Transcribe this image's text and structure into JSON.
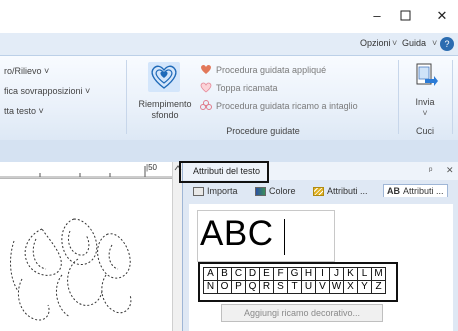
{
  "window": {
    "controls": {
      "minimize": "–",
      "maximize": "☐",
      "close": "✕"
    }
  },
  "ribbon_tabs": {
    "options": "Opzioni",
    "guide": "Guida",
    "chevron": "˅",
    "help_icon": "?"
  },
  "ribbon": {
    "left_items": [
      "ro/Rilievo ˅",
      "fica sovrapposizioni ˅",
      "tta testo ˅"
    ],
    "fill_button": {
      "line1": "Riempimento",
      "line2": "sfondo"
    },
    "wizards": [
      {
        "label": "Procedura guidata appliqué",
        "icon": "heart-icon"
      },
      {
        "label": "Toppa ricamata",
        "icon": "heart-outline-icon"
      },
      {
        "label": "Procedura guidata ricamo a intaglio",
        "icon": "flower-icon"
      }
    ],
    "wizards_group_label": "Procedure guidate",
    "send_button": {
      "label": "Invia",
      "arrow": "˅"
    },
    "cuci_label": "Cuci"
  },
  "ruler": {
    "mark": "|50"
  },
  "pane": {
    "title": "Attributi del testo",
    "pin": "ᵖ",
    "close": "✕",
    "tabs": [
      {
        "label": "Importa",
        "icon": "import-icon"
      },
      {
        "label": "Colore",
        "icon": "color-icon"
      },
      {
        "label": "Attributi ...",
        "icon": "stitch-attributes-icon"
      },
      {
        "label": "Attributi ...",
        "icon": "text-attributes-icon",
        "prefix": "AB",
        "active": true
      }
    ],
    "preview_text": "ABC",
    "alphabet_row1": [
      "A",
      "B",
      "C",
      "D",
      "E",
      "F",
      "G",
      "H",
      "I",
      "J",
      "K",
      "L",
      "M"
    ],
    "alphabet_row2": [
      "N",
      "O",
      "P",
      "Q",
      "R",
      "S",
      "T",
      "U",
      "V",
      "W",
      "X",
      "Y",
      "Z"
    ],
    "add_button": "Aggiungi ricamo decorativo..."
  },
  "colors": {
    "accent": "#2b6cb0",
    "ribbon_bg": "#eaf1fa",
    "pane_bg": "#dfe8f4"
  }
}
